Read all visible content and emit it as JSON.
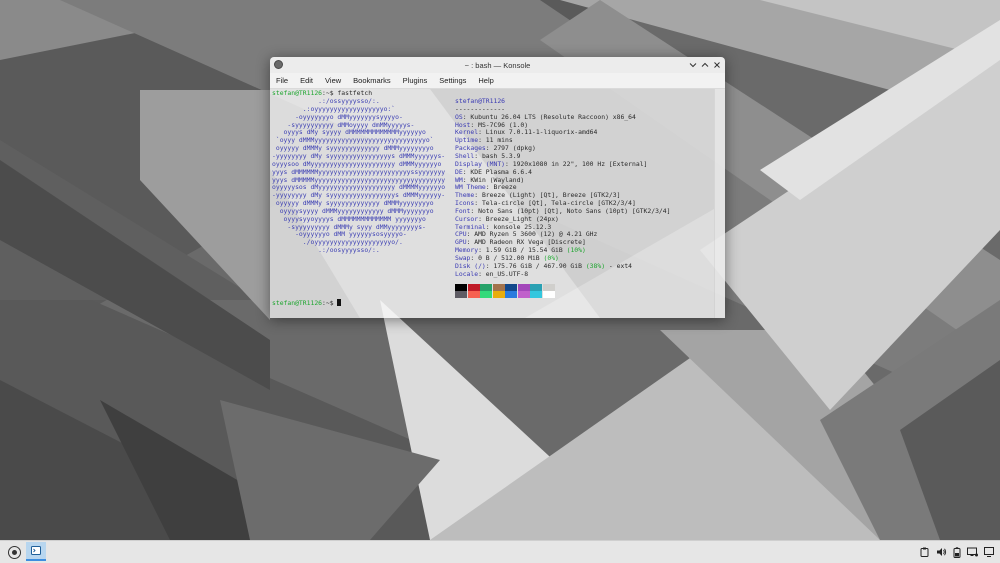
{
  "window": {
    "title": "~ : bash — Konsole",
    "icon": "konsole-icon",
    "controls": [
      "chevron-down-icon",
      "minimize-icon",
      "maximize-icon",
      "close-icon"
    ]
  },
  "menu": [
    "File",
    "Edit",
    "View",
    "Bookmarks",
    "Plugins",
    "Settings",
    "Help"
  ],
  "terminal": {
    "prompt_user": "stefan@TR1126",
    "prompt_path": ":~$ ",
    "command": "fastfetch",
    "ascii_art": [
      "            .:/ossyyyysso/:.",
      "        .:oyyyyyyyyyyyyyyyyyyo:`",
      "      -oyyyyyyyo dMMyyyyyyysyyyyo-",
      "    -syyyyyyyyyy dMMoyyyy dmMMyyyyys-",
      "   oyyys dMy syyyy dMMMMMMMMMMMMMyyyyyyo",
      " `oyyy dMMMyyyyyyyyyyyyyyyyyyyyyyyyyyyyyo`",
      " oyyyyy dMMMy syyyyyyyyyyyyy dMMMyyyyyyyyo",
      "-yyyyyyyy dMy syyyyyyyyyyyyyyyys dMMMyyyyyys-",
      "oyyysoo dMyyyyyyyyyyyyyyyyyyyyyy dMMMyyyyyyo",
      "yyys dMMMMMMyyyyyyyyyyyyyyyyyyyyyyyyssyyyyyyy",
      "yyys dMMMMMyyyyyyyyyyyyyyyyyyyyyyyyyyyyyyyyyy",
      "oyyyyysos dMyyyyyyyyyyyyyyyyyyyy dMMMMyyyyyyo",
      "-yyyyyyyy dMy syyyyyyyyyyyyyyyyys dMMMyyyyyy-",
      " oyyyyy dMMMy syyyyyyyyyyyyy dMMMyyyyyyyyo",
      "  oyyyysyyyy dMMMyyyyyyyyyyyy dMMMyyyyyyyo",
      "   oyyysyyoyyyys dMMMMMMMMMMMMM yyyyyyyo",
      "    -syyyyyyyyy dMMMy syyy dMMyyyyyyyys-",
      "      -oyyyyyyo dMM yyyyyysosyyyyo-",
      "        ./oyyyyyyyyyyyyyyyyyyyyo/.",
      "            .:/oosyyyysso/:."
    ],
    "info": [
      {
        "key": "",
        "value": "stefan@TR1126",
        "user": true
      },
      {
        "key": "",
        "value": "-------------"
      },
      {
        "key": "OS",
        "value": "Kubuntu 26.04 LTS (Resolute Raccoon) x86_64"
      },
      {
        "key": "Host",
        "value": "MS-7C96 (1.0)"
      },
      {
        "key": "Kernel",
        "value": "Linux 7.0.11-1-liquorix-amd64"
      },
      {
        "key": "Uptime",
        "value": "11 mins"
      },
      {
        "key": "Packages",
        "value": "2797 (dpkg)"
      },
      {
        "key": "Shell",
        "value": "bash 5.3.9"
      },
      {
        "key": "Display (MNT)",
        "value": "1920x1080 in 22\", 100 Hz [External]"
      },
      {
        "key": "DE",
        "value": "KDE Plasma 6.6.4"
      },
      {
        "key": "WM",
        "value": "KWin (Wayland)"
      },
      {
        "key": "WM Theme",
        "value": "Breeze"
      },
      {
        "key": "Theme",
        "value": "Breeze (Light) [Qt], Breeze [GTK2/3]"
      },
      {
        "key": "Icons",
        "value": "Tela-circle [Qt], Tela-circle [GTK2/3/4]"
      },
      {
        "key": "Font",
        "value": "Noto Sans (10pt) [Qt], Noto Sans (10pt) [GTK2/3/4]"
      },
      {
        "key": "Cursor",
        "value": "Breeze_Light (24px)"
      },
      {
        "key": "Terminal",
        "value": "konsole 25.12.3"
      },
      {
        "key": "CPU",
        "value": "AMD Ryzen 5 3600 (12) @ 4.21 GHz"
      },
      {
        "key": "GPU",
        "value": "AMD Radeon RX Vega [Discrete]"
      },
      {
        "key": "Memory",
        "value": "1.59 GiB / 15.54 GiB ",
        "pct": "(10%)"
      },
      {
        "key": "Swap",
        "value": "0 B / 512.00 MiB ",
        "pct": "(0%)"
      },
      {
        "key": "Disk (/)",
        "value": "175.76 GiB / 467.90 GiB ",
        "pct": "(38%)",
        "tail": " - ext4"
      },
      {
        "key": "Locale",
        "value": "en_US.UTF-8"
      }
    ],
    "palette_top": [
      "#000000",
      "#c01c28",
      "#26a269",
      "#a2734c",
      "#12488b",
      "#a347ba",
      "#2aa1b3",
      "#d0cfcc"
    ],
    "palette_bottom": [
      "#5e5c64",
      "#f66151",
      "#33da7a",
      "#e9ad0c",
      "#2a7bde",
      "#c061cb",
      "#33c7de",
      "#ffffff"
    ]
  },
  "taskbar": {
    "launcher_icon": "app-launcher-icon",
    "task_icon": "konsole-task-icon",
    "tray_icons": [
      "clipboard-icon",
      "volume-icon",
      "battery-icon",
      "network-icon",
      "show-desktop-icon"
    ]
  }
}
